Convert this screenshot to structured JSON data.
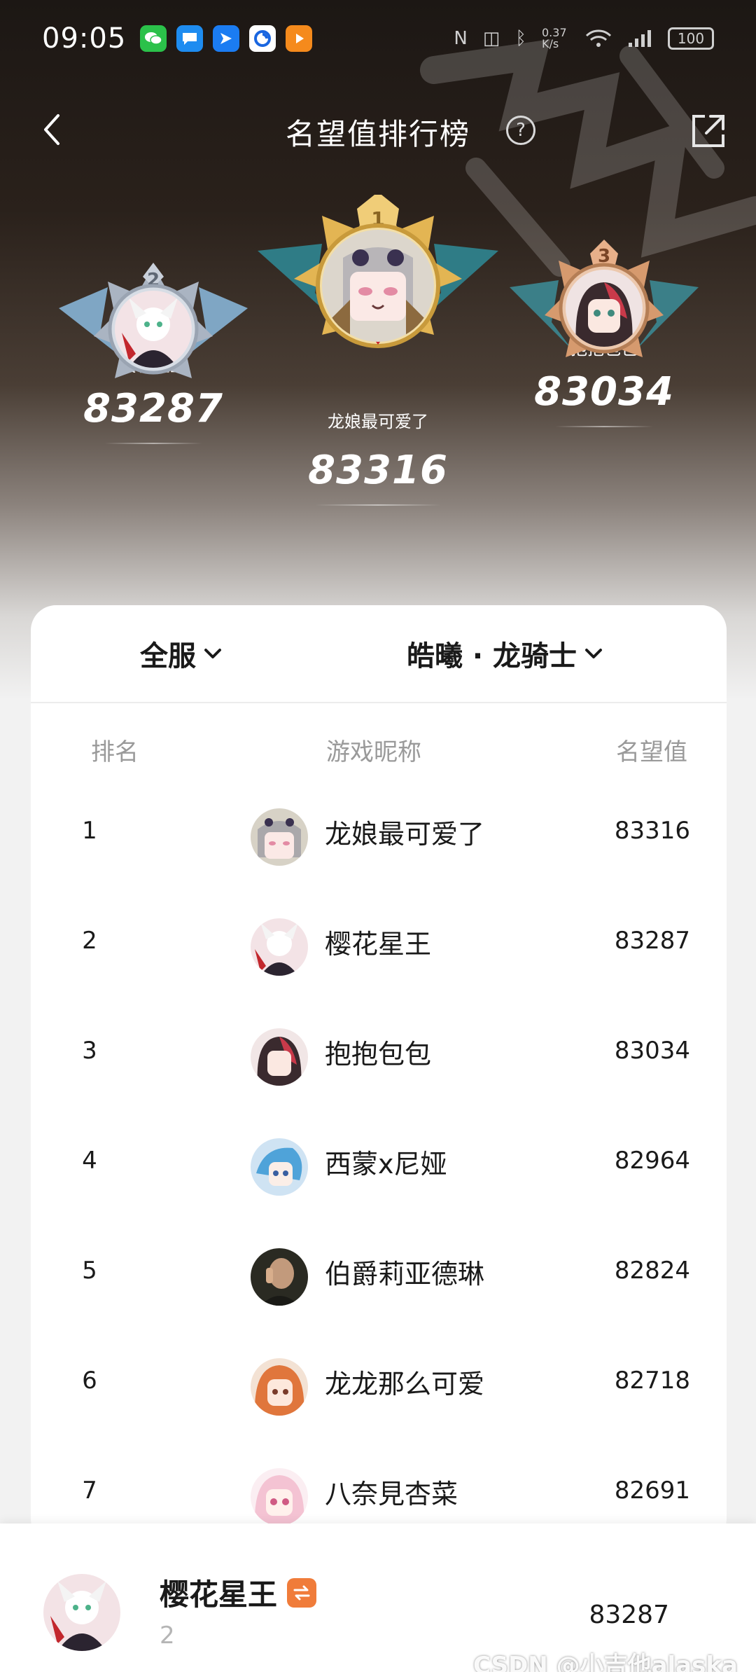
{
  "status_bar": {
    "time": "09:05",
    "net_speed": "0.37 K/s",
    "battery": "100",
    "apps": [
      {
        "icon": "wechat-icon",
        "color": "#2bc14a"
      },
      {
        "icon": "message-icon",
        "color": "#1e8cf0"
      },
      {
        "icon": "feishu-icon",
        "color": "#1b7cf2"
      },
      {
        "icon": "browser-icon",
        "color": "#1a66e0"
      },
      {
        "icon": "video-icon",
        "color": "#f58a1c"
      }
    ]
  },
  "header": {
    "title": "名望值排行榜",
    "help_icon": "?"
  },
  "podium": {
    "first": {
      "rank": "1",
      "name": "龙娘最可爱了",
      "score": "83316"
    },
    "second": {
      "rank": "2",
      "name": "樱花星王",
      "score": "83287"
    },
    "third": {
      "rank": "3",
      "name": "抱抱包包",
      "score": "83034"
    }
  },
  "filters": {
    "server": "全服",
    "hero": "皓曦 · 龙骑士"
  },
  "table": {
    "headers": {
      "rank": "排名",
      "nickname": "游戏昵称",
      "score": "名望值"
    },
    "rows": [
      {
        "rank": "1",
        "name": "龙娘最可爱了",
        "score": "83316"
      },
      {
        "rank": "2",
        "name": "樱花星王",
        "score": "83287"
      },
      {
        "rank": "3",
        "name": "抱抱包包",
        "score": "83034"
      },
      {
        "rank": "4",
        "name": "西蒙x尼娅",
        "score": "82964"
      },
      {
        "rank": "5",
        "name": "伯爵莉亚德琳",
        "score": "82824"
      },
      {
        "rank": "6",
        "name": "龙龙那么可爱",
        "score": "82718"
      },
      {
        "rank": "7",
        "name": "八奈見杏菜",
        "score": "82691"
      }
    ]
  },
  "me": {
    "name": "樱花星王",
    "rank": "2",
    "score": "83287"
  },
  "watermark": "CSDN @小吉他alaska",
  "colors": {
    "accent_orange": "#f07c3a",
    "gold": "#e3b553",
    "silver": "#aab4c2",
    "bronze": "#d69a6e"
  }
}
